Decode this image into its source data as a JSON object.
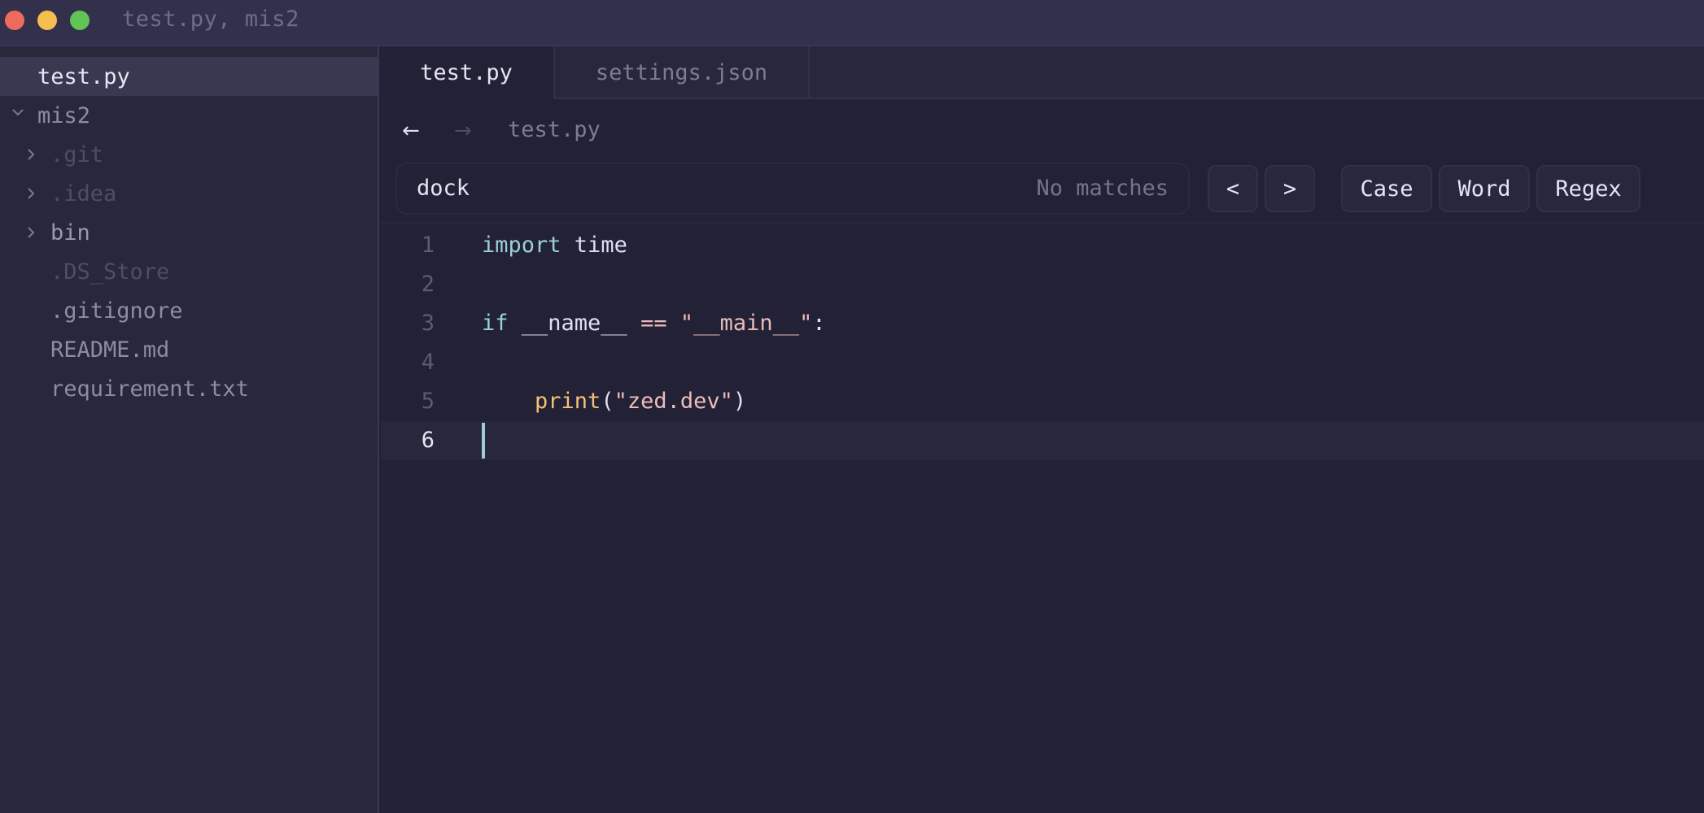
{
  "window": {
    "title": "test.py, mis2",
    "traffic_lights": [
      {
        "name": "close",
        "color": "#ee6a5f"
      },
      {
        "name": "minimize",
        "color": "#f5be4f"
      },
      {
        "name": "maximize",
        "color": "#61c454"
      }
    ]
  },
  "sidebar": {
    "open_file": "test.py",
    "root": {
      "label": "mis2",
      "expanded": true
    },
    "items": [
      {
        "label": ".git",
        "type": "folder",
        "expanded": false,
        "ignored": true
      },
      {
        "label": ".idea",
        "type": "folder",
        "expanded": false,
        "ignored": true
      },
      {
        "label": "bin",
        "type": "folder",
        "expanded": false,
        "ignored": false
      },
      {
        "label": ".DS_Store",
        "type": "file",
        "ignored": true
      },
      {
        "label": ".gitignore",
        "type": "file",
        "ignored": false
      },
      {
        "label": "README.md",
        "type": "file",
        "ignored": false
      },
      {
        "label": "requirement.txt",
        "type": "file",
        "ignored": false
      }
    ],
    "chevron_collapsed": "›",
    "chevron_expanded": "⌄"
  },
  "tabs": [
    {
      "label": "test.py",
      "active": true
    },
    {
      "label": "settings.json",
      "active": false
    }
  ],
  "nav": {
    "back_icon": "←",
    "forward_icon": "→",
    "breadcrumb": "test.py"
  },
  "search": {
    "query": "dock",
    "status": "No matches",
    "prev_label": "<",
    "next_label": ">",
    "case_label": "Case",
    "word_label": "Word",
    "regex_label": "Regex"
  },
  "editor": {
    "current_line": 6,
    "lines": [
      {
        "number": "1",
        "tokens": [
          {
            "t": "import",
            "k": "keyword"
          },
          {
            "t": " time",
            "k": "plain"
          }
        ]
      },
      {
        "number": "2",
        "tokens": []
      },
      {
        "number": "3",
        "tokens": [
          {
            "t": "if",
            "k": "keyword"
          },
          {
            "t": " __name__ ",
            "k": "plain"
          },
          {
            "t": "==",
            "k": "op"
          },
          {
            "t": " ",
            "k": "plain"
          },
          {
            "t": "\"__main__\"",
            "k": "string"
          },
          {
            "t": ":",
            "k": "plain"
          }
        ]
      },
      {
        "number": "4",
        "tokens": []
      },
      {
        "number": "5",
        "tokens": [
          {
            "t": "    ",
            "k": "plain"
          },
          {
            "t": "print",
            "k": "func"
          },
          {
            "t": "(",
            "k": "plain"
          },
          {
            "t": "\"zed.dev\"",
            "k": "string"
          },
          {
            "t": ")",
            "k": "plain"
          }
        ]
      },
      {
        "number": "6",
        "tokens": []
      }
    ]
  },
  "colors": {
    "keyword": "#9ccfd8",
    "string": "#ebbcba",
    "function": "#f6c177",
    "cursor": "#9ccfd8",
    "text": "#e0def4"
  }
}
